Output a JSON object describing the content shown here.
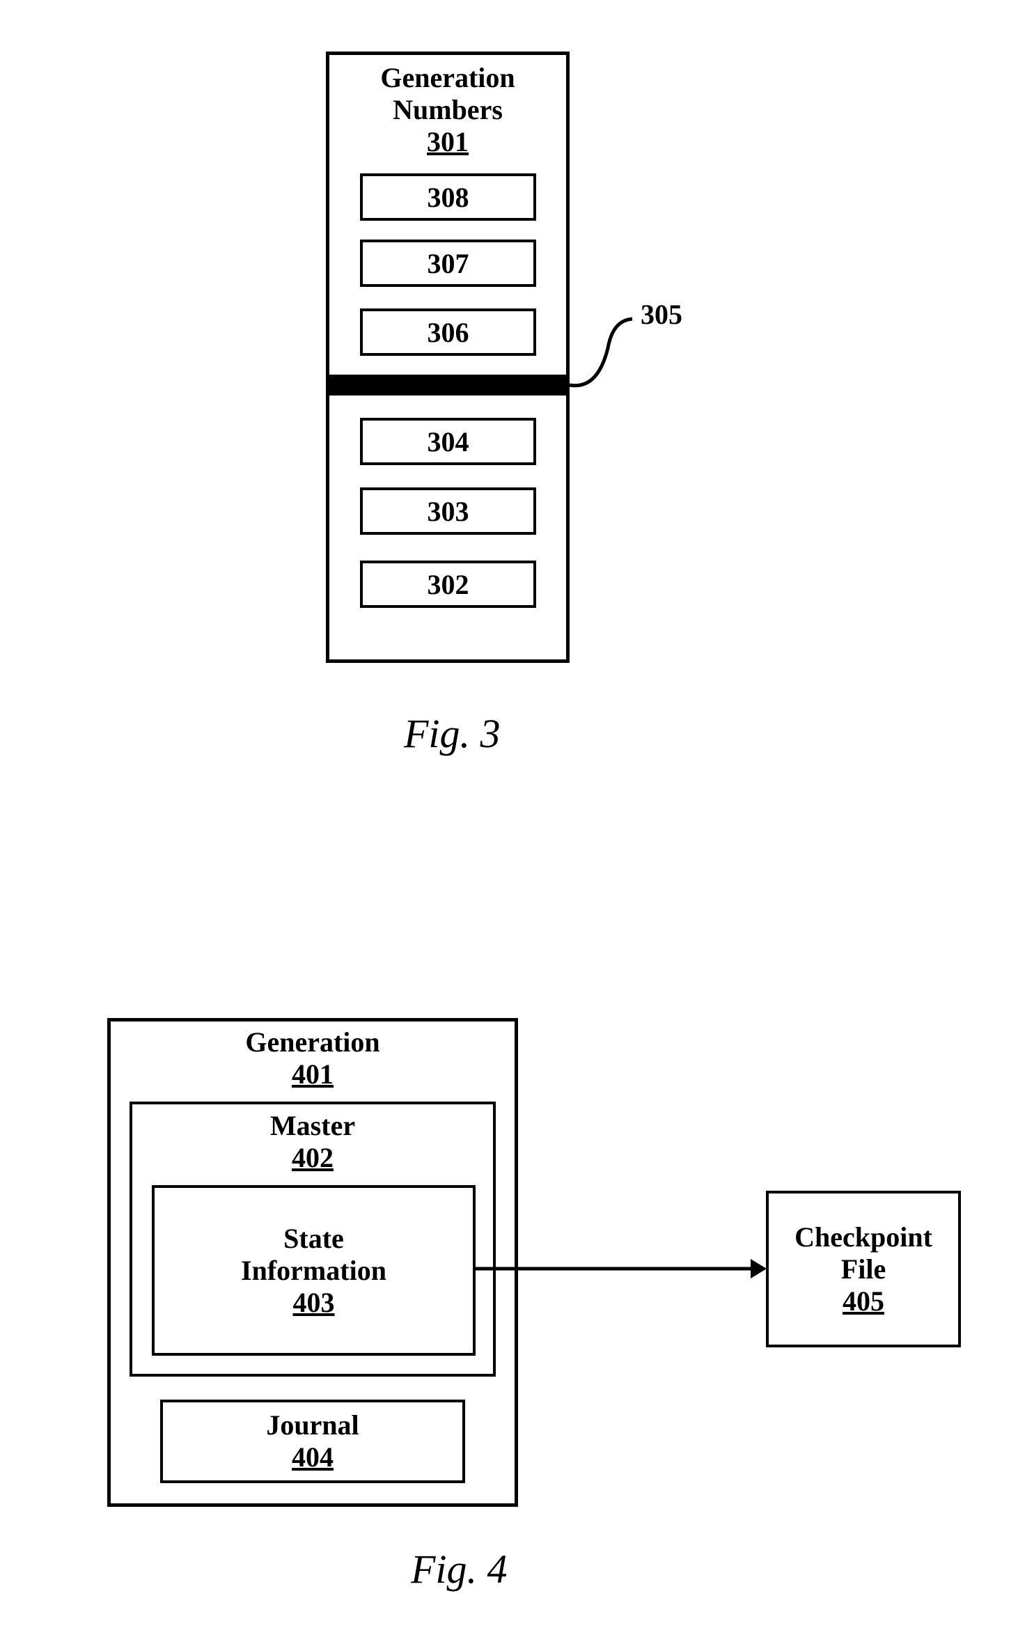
{
  "fig3": {
    "container_title_line1": "Generation",
    "container_title_line2": "Numbers",
    "container_ref": "301",
    "upper_items": [
      "308",
      "307",
      "306"
    ],
    "lower_items": [
      "304",
      "303",
      "302"
    ],
    "divider_label": "305",
    "caption": "Fig. 3"
  },
  "fig4": {
    "generation_title": "Generation",
    "generation_ref": "401",
    "master_title": "Master",
    "master_ref": "402",
    "state_title_line1": "State",
    "state_title_line2": "Information",
    "state_ref": "403",
    "journal_title": "Journal",
    "journal_ref": "404",
    "checkpoint_title_line1": "Checkpoint",
    "checkpoint_title_line2": "File",
    "checkpoint_ref": "405",
    "caption": "Fig. 4"
  }
}
